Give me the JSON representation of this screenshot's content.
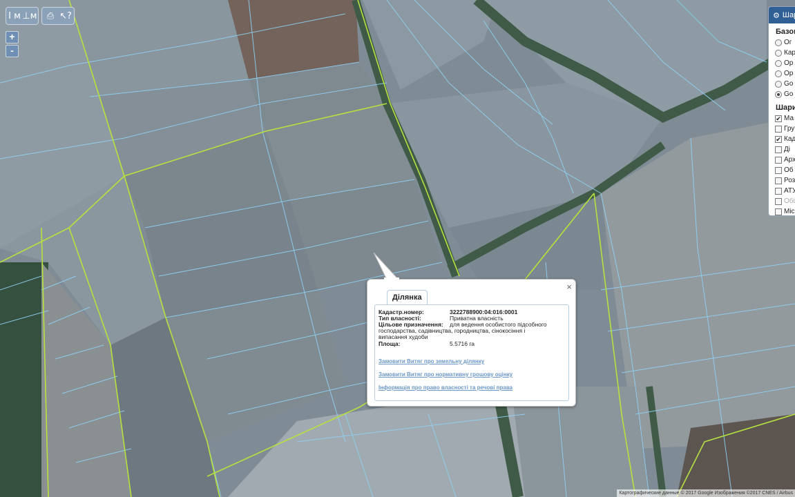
{
  "toolbar": {
    "measure_length_label": "I м",
    "measure_area_label": "⊥м",
    "print_label": "⎙",
    "identify_label": "↖?"
  },
  "zoom": {
    "in_label": "+",
    "out_label": "-"
  },
  "layers_panel": {
    "title": "Шар",
    "base_section": "Базові",
    "base_items": [
      {
        "label": "Ог",
        "selected": false
      },
      {
        "label": "Кар",
        "selected": false
      },
      {
        "label": "Ор",
        "selected": false
      },
      {
        "label": "Ор",
        "selected": false
      },
      {
        "label": "Go",
        "selected": false
      },
      {
        "label": "Go",
        "selected": true
      }
    ],
    "layers_section": "Шари",
    "layer_items": [
      {
        "label": "Ма",
        "checked": true,
        "enabled": true
      },
      {
        "label": "Гру",
        "checked": false,
        "enabled": true
      },
      {
        "label": "Кад",
        "checked": true,
        "enabled": true
      },
      {
        "label": "Ді",
        "checked": false,
        "enabled": true
      },
      {
        "label": "Арх",
        "checked": false,
        "enabled": true
      },
      {
        "label": "Об",
        "checked": false,
        "enabled": true
      },
      {
        "label": "Роз",
        "checked": false,
        "enabled": true
      },
      {
        "label": "АТУ",
        "checked": false,
        "enabled": true
      },
      {
        "label": "Обі",
        "checked": false,
        "enabled": false
      },
      {
        "label": "Міс",
        "checked": false,
        "enabled": true
      }
    ]
  },
  "popup": {
    "tab_label": "Ділянка",
    "close_label": "×",
    "fields": {
      "cadastral_key": "Кадастр.номер:",
      "cadastral_value": "3222788900:04:016:0001",
      "ownership_key": "Тип власності:",
      "ownership_value": "Приватна власність",
      "purpose_key": "Цільове призначення:",
      "purpose_value_1": "для ведення особистого підсобного",
      "purpose_value_2": "господарства, садівництва, городництва, сінокосіння і",
      "purpose_value_3": "випасання худоби",
      "area_key": "Площа:",
      "area_value": "5.5716 га"
    },
    "links": [
      "Замовити Витяг про земельну ділянку",
      "Замовити Витяг про нормативну грошову оцінку",
      "Інформація про право власності та речові права"
    ]
  },
  "attribution": "Картографические данные © 2017 Google Изображения ©2017 CNES / Airbus"
}
